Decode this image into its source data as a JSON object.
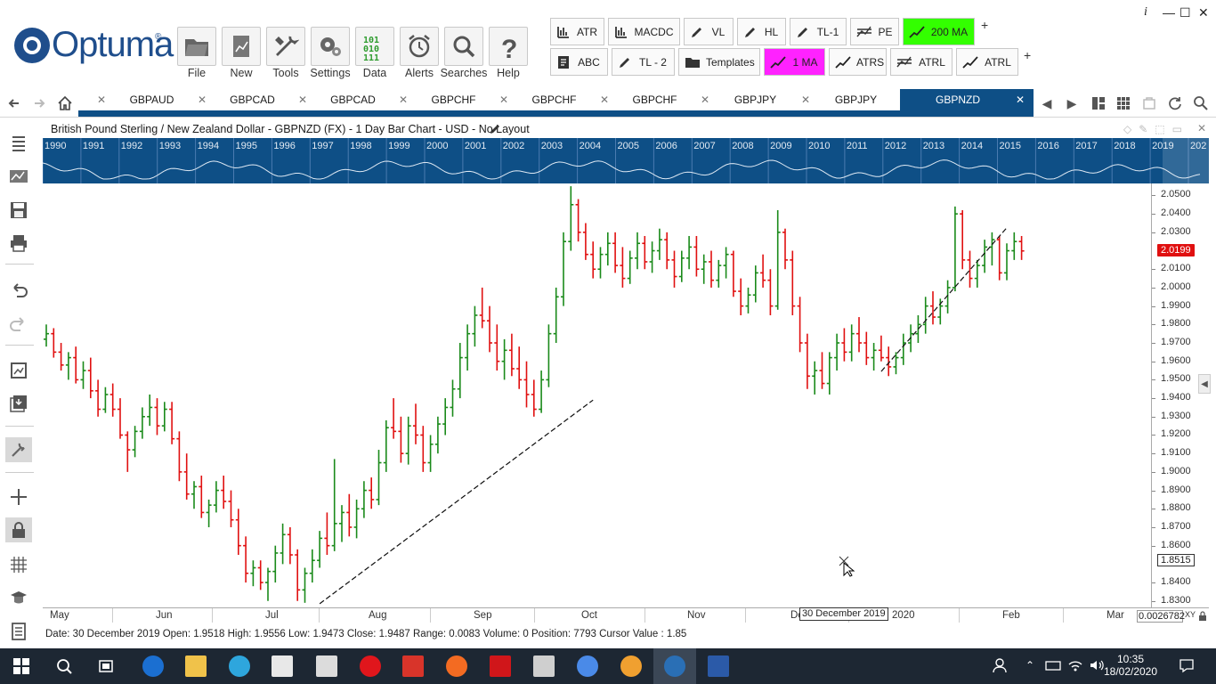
{
  "window": {
    "info_icon": "info-icon",
    "min": "—",
    "max": "☐",
    "close": "✕"
  },
  "brand": {
    "name": "Optuma",
    "reg": "®"
  },
  "menu": [
    {
      "label": "File",
      "icon": "folder-icon"
    },
    {
      "label": "New",
      "icon": "new-chart-icon"
    },
    {
      "label": "Tools",
      "icon": "tools-icon"
    },
    {
      "label": "Settings",
      "icon": "settings-icon"
    },
    {
      "label": "Data",
      "icon": "data-icon"
    },
    {
      "label": "Alerts",
      "icon": "alarm-clock-icon"
    },
    {
      "label": "Searches",
      "icon": "search-icon"
    },
    {
      "label": "Help",
      "icon": "help-icon"
    }
  ],
  "toolbar_row1": [
    {
      "label": "ATR",
      "icon": "bar-chart-icon",
      "bg": "#fafafa",
      "fg": "#222"
    },
    {
      "label": "MACDC",
      "icon": "bar-chart-icon",
      "bg": "#fafafa",
      "fg": "#222"
    },
    {
      "label": "VL",
      "icon": "pencil-icon",
      "bg": "#fafafa",
      "fg": "#222"
    },
    {
      "label": "HL",
      "icon": "pencil-icon",
      "bg": "#fafafa",
      "fg": "#222"
    },
    {
      "label": "TL-1",
      "icon": "pencil-icon",
      "bg": "#fafafa",
      "fg": "#222"
    },
    {
      "label": "PE",
      "icon": "pe-icon",
      "bg": "#fafafa",
      "fg": "#222"
    },
    {
      "label": "200 MA",
      "icon": "line-icon",
      "bg": "#33ff00",
      "fg": "#222"
    }
  ],
  "toolbar_row2": [
    {
      "label": "ABC",
      "icon": "document-icon",
      "bg": "#fafafa",
      "fg": "#222"
    },
    {
      "label": "TL - 2",
      "icon": "pencil-icon",
      "bg": "#fafafa",
      "fg": "#222"
    },
    {
      "label": "Templates",
      "icon": "folder-icon",
      "bg": "#fafafa",
      "fg": "#222"
    },
    {
      "label": "1 MA",
      "icon": "line-icon",
      "bg": "#ff22ff",
      "fg": "#222"
    },
    {
      "label": "ATRS",
      "icon": "line-icon",
      "bg": "#fafafa",
      "fg": "#222"
    },
    {
      "label": "ATRL",
      "icon": "pe-icon",
      "bg": "#fafafa",
      "fg": "#222"
    },
    {
      "label": "ATRL",
      "icon": "line-icon",
      "bg": "#fafafa",
      "fg": "#222"
    }
  ],
  "add_label": "+",
  "tabs": [
    "GBPAUD",
    "GBPCAD",
    "GBPCAD",
    "GBPCHF",
    "GBPCHF",
    "GBPCHF",
    "GBPJPY",
    "GBPJPY",
    "GBPNZD"
  ],
  "active_tab": "GBPNZD",
  "tab_close": "✕",
  "chart_title": "British Pound Sterling / New Zealand Dollar - GBPNZD (FX) - 1 Day Bar Chart - USD - No Layout",
  "overview_years": [
    "1990",
    "1991",
    "1992",
    "1993",
    "1994",
    "1995",
    "1996",
    "1997",
    "1998",
    "1999",
    "2000",
    "2001",
    "2002",
    "2003",
    "2004",
    "2005",
    "2006",
    "2007",
    "2008",
    "2009",
    "2010",
    "2011",
    "2012",
    "2013",
    "2014",
    "2015",
    "2016",
    "2017",
    "2018",
    "2019",
    "202"
  ],
  "price_labels": [
    "2.0500",
    "2.0400",
    "2.0300",
    "2.0100",
    "2.0000",
    "1.9900",
    "1.9800",
    "1.9700",
    "1.9600",
    "1.9500",
    "1.9400",
    "1.9300",
    "1.9200",
    "1.9100",
    "1.9000",
    "1.8900",
    "1.8800",
    "1.8700",
    "1.8600",
    "1.8400",
    "1.8300"
  ],
  "last_price": "2.0199",
  "cursor_price": "1.8515",
  "month_labels": [
    "May",
    "Jun",
    "Jul",
    "Aug",
    "Sep",
    "Oct",
    "Nov",
    "De",
    "2020",
    "Feb",
    "Mar"
  ],
  "cursor_date": "30 December 2019",
  "scale_readout": "0.0026782",
  "scale_xy": "XY",
  "status_line": "Date: 30 December 2019 Open: 1.9518 High: 1.9556 Low: 1.9473 Close: 1.9487 Range: 0.0083 Volume: 0 Position: 7793 Cursor Value : 1.85",
  "colors": {
    "up": "#1a8a1a",
    "down": "#e01010",
    "overview": "#0e4f86",
    "last_price_bg": "#e01010"
  },
  "chart_data": {
    "type": "ohlc-bar",
    "ylim": [
      1.8265,
      2.0565
    ],
    "bars": [
      [
        1.972,
        1.98,
        1.968,
        1.975
      ],
      [
        1.975,
        1.978,
        1.962,
        1.965
      ],
      [
        1.965,
        1.97,
        1.955,
        1.958
      ],
      [
        1.958,
        1.965,
        1.95,
        1.962
      ],
      [
        1.962,
        1.968,
        1.948,
        1.95
      ],
      [
        1.95,
        1.96,
        1.945,
        1.955
      ],
      [
        1.955,
        1.962,
        1.94,
        1.944
      ],
      [
        1.944,
        1.95,
        1.93,
        1.934
      ],
      [
        1.934,
        1.946,
        1.932,
        1.942
      ],
      [
        1.942,
        1.948,
        1.93,
        1.934
      ],
      [
        1.934,
        1.94,
        1.918,
        1.92
      ],
      [
        1.92,
        1.922,
        1.9,
        1.912
      ],
      [
        1.912,
        1.925,
        1.908,
        1.922
      ],
      [
        1.922,
        1.935,
        1.918,
        1.93
      ],
      [
        1.93,
        1.942,
        1.925,
        1.935
      ],
      [
        1.935,
        1.94,
        1.92,
        1.925
      ],
      [
        1.925,
        1.938,
        1.922,
        1.934
      ],
      [
        1.934,
        1.938,
        1.915,
        1.918
      ],
      [
        1.918,
        1.922,
        1.895,
        1.9
      ],
      [
        1.9,
        1.91,
        1.885,
        1.888
      ],
      [
        1.888,
        1.895,
        1.88,
        1.892
      ],
      [
        1.892,
        1.898,
        1.875,
        1.878
      ],
      [
        1.878,
        1.885,
        1.87,
        1.882
      ],
      [
        1.882,
        1.895,
        1.878,
        1.89
      ],
      [
        1.89,
        1.898,
        1.88,
        1.884
      ],
      [
        1.884,
        1.89,
        1.87,
        1.874
      ],
      [
        1.874,
        1.88,
        1.855,
        1.86
      ],
      [
        1.86,
        1.865,
        1.84,
        1.845
      ],
      [
        1.845,
        1.852,
        1.838,
        1.848
      ],
      [
        1.848,
        1.852,
        1.836,
        1.84
      ],
      [
        1.84,
        1.848,
        1.83,
        1.846
      ],
      [
        1.846,
        1.86,
        1.84,
        1.856
      ],
      [
        1.856,
        1.872,
        1.85,
        1.866
      ],
      [
        1.866,
        1.87,
        1.85,
        1.855
      ],
      [
        1.855,
        1.858,
        1.83,
        1.836
      ],
      [
        1.836,
        1.848,
        1.829,
        1.845
      ],
      [
        1.845,
        1.858,
        1.84,
        1.852
      ],
      [
        1.852,
        1.868,
        1.848,
        1.864
      ],
      [
        1.864,
        1.878,
        1.855,
        1.86
      ],
      [
        1.86,
        1.907,
        1.857,
        1.872
      ],
      [
        1.872,
        1.882,
        1.862,
        1.878
      ],
      [
        1.878,
        1.888,
        1.865,
        1.87
      ],
      [
        1.87,
        1.885,
        1.864,
        1.88
      ],
      [
        1.88,
        1.895,
        1.875,
        1.89
      ],
      [
        1.89,
        1.897,
        1.88,
        1.885
      ],
      [
        1.885,
        1.912,
        1.882,
        1.905
      ],
      [
        1.905,
        1.928,
        1.9,
        1.924
      ],
      [
        1.924,
        1.94,
        1.918,
        1.922
      ],
      [
        1.922,
        1.93,
        1.905,
        1.91
      ],
      [
        1.91,
        1.93,
        1.904,
        1.925
      ],
      [
        1.925,
        1.937,
        1.915,
        1.92
      ],
      [
        1.92,
        1.925,
        1.9,
        1.905
      ],
      [
        1.905,
        1.92,
        1.9,
        1.915
      ],
      [
        1.915,
        1.93,
        1.91,
        1.926
      ],
      [
        1.926,
        1.94,
        1.92,
        1.935
      ],
      [
        1.935,
        1.95,
        1.93,
        1.945
      ],
      [
        1.945,
        1.97,
        1.94,
        1.962
      ],
      [
        1.962,
        1.98,
        1.955,
        1.975
      ],
      [
        1.975,
        1.99,
        1.968,
        1.985
      ],
      [
        1.985,
        2.0,
        1.978,
        1.982
      ],
      [
        1.982,
        1.99,
        1.965,
        1.97
      ],
      [
        1.97,
        1.98,
        1.955,
        1.96
      ],
      [
        1.96,
        1.972,
        1.95,
        1.966
      ],
      [
        1.966,
        1.975,
        1.952,
        1.956
      ],
      [
        1.956,
        1.968,
        1.945,
        1.95
      ],
      [
        1.95,
        1.96,
        1.935,
        1.942
      ],
      [
        1.942,
        1.95,
        1.93,
        1.934
      ],
      [
        1.934,
        1.955,
        1.932,
        1.95
      ],
      [
        1.95,
        1.98,
        1.946,
        1.975
      ],
      [
        1.975,
        2.0,
        1.97,
        1.995
      ],
      [
        1.995,
        2.03,
        1.99,
        2.025
      ],
      [
        2.025,
        2.055,
        2.02,
        2.045
      ],
      [
        2.045,
        2.048,
        2.025,
        2.03
      ],
      [
        2.03,
        2.035,
        2.015,
        2.018
      ],
      [
        2.018,
        2.025,
        2.005,
        2.01
      ],
      [
        2.01,
        2.022,
        2.005,
        2.018
      ],
      [
        2.018,
        2.03,
        2.012,
        2.024
      ],
      [
        2.024,
        2.03,
        2.008,
        2.012
      ],
      [
        2.012,
        2.022,
        2.0,
        2.005
      ],
      [
        2.005,
        2.02,
        2.002,
        2.016
      ],
      [
        2.016,
        2.03,
        2.01,
        2.024
      ],
      [
        2.024,
        2.028,
        2.01,
        2.014
      ],
      [
        2.014,
        2.025,
        2.008,
        2.02
      ],
      [
        2.02,
        2.032,
        2.015,
        2.026
      ],
      [
        2.026,
        2.03,
        2.01,
        2.015
      ],
      [
        2.015,
        2.02,
        2.0,
        2.006
      ],
      [
        2.006,
        2.02,
        2.003,
        2.016
      ],
      [
        2.016,
        2.028,
        2.01,
        2.022
      ],
      [
        2.022,
        2.028,
        2.006,
        2.01
      ],
      [
        2.01,
        2.018,
        2.002,
        2.014
      ],
      [
        2.014,
        2.02,
        2.0,
        2.004
      ],
      [
        2.004,
        2.015,
        2.0,
        2.012
      ],
      [
        2.012,
        2.022,
        2.005,
        2.018
      ],
      [
        2.018,
        2.02,
        1.995,
        1.998
      ],
      [
        1.998,
        2.005,
        1.985,
        1.99
      ],
      [
        1.99,
        2.0,
        1.986,
        1.996
      ],
      [
        1.996,
        2.012,
        1.992,
        2.008
      ],
      [
        2.008,
        2.018,
        2.0,
        2.004
      ],
      [
        2.004,
        2.01,
        1.985,
        1.99
      ],
      [
        1.99,
        2.042,
        1.988,
        2.03
      ],
      [
        2.03,
        2.032,
        2.01,
        2.015
      ],
      [
        2.015,
        2.02,
        1.985,
        1.99
      ],
      [
        1.99,
        1.995,
        1.965,
        1.97
      ],
      [
        1.97,
        1.975,
        1.945,
        1.952
      ],
      [
        1.952,
        1.96,
        1.942,
        1.955
      ],
      [
        1.955,
        1.965,
        1.945,
        1.948
      ],
      [
        1.948,
        1.965,
        1.942,
        1.962
      ],
      [
        1.962,
        1.975,
        1.955,
        1.97
      ],
      [
        1.97,
        1.978,
        1.96,
        1.965
      ],
      [
        1.965,
        1.98,
        1.96,
        1.975
      ],
      [
        1.975,
        1.984,
        1.965,
        1.97
      ],
      [
        1.97,
        1.976,
        1.958,
        1.962
      ],
      [
        1.962,
        1.97,
        1.955,
        1.966
      ],
      [
        1.966,
        1.974,
        1.96,
        1.962
      ],
      [
        1.962,
        1.968,
        1.952,
        1.957
      ],
      [
        1.957,
        1.965,
        1.953,
        1.962
      ],
      [
        1.962,
        1.975,
        1.958,
        1.97
      ],
      [
        1.97,
        1.98,
        1.965,
        1.975
      ],
      [
        1.975,
        1.985,
        1.97,
        1.98
      ],
      [
        1.98,
        1.995,
        1.975,
        1.99
      ],
      [
        1.99,
        1.998,
        1.98,
        1.984
      ],
      [
        1.984,
        1.994,
        1.98,
        1.99
      ],
      [
        1.99,
        2.004,
        1.986,
        2.0
      ],
      [
        2.0,
        2.044,
        1.998,
        2.04
      ],
      [
        2.04,
        2.042,
        2.01,
        2.015
      ],
      [
        2.015,
        2.02,
        2.0,
        2.005
      ],
      [
        2.005,
        2.015,
        2.0,
        2.012
      ],
      [
        2.012,
        2.026,
        2.008,
        2.022
      ],
      [
        2.022,
        2.03,
        2.012,
        2.026
      ],
      [
        2.026,
        2.028,
        2.004,
        2.008
      ],
      [
        2.008,
        2.024,
        2.004,
        2.02
      ],
      [
        2.02,
        2.03,
        2.015,
        2.025
      ],
      [
        2.025,
        2.028,
        2.015,
        2.0199
      ]
    ],
    "trendlines": [
      {
        "from": [
          37,
          1.8285
        ],
        "to": [
          74,
          1.939
        ]
      },
      {
        "from": [
          113,
          1.9545
        ],
        "to": [
          130,
          2.0325
        ]
      }
    ],
    "cursor_line": 1.8515
  }
}
